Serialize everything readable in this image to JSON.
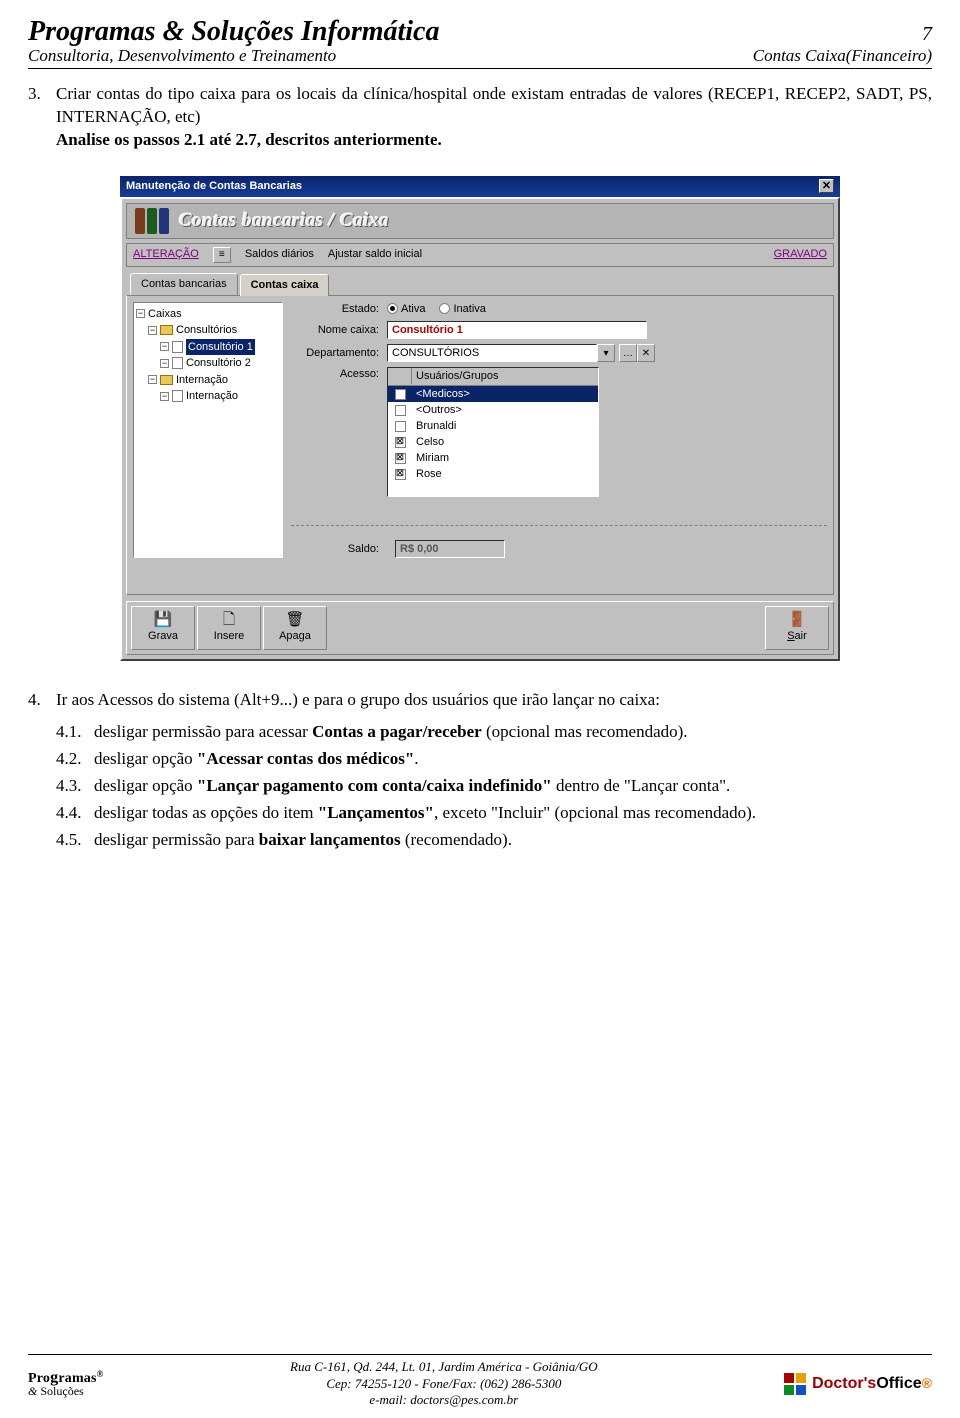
{
  "header": {
    "title": "Programas & Soluções Informática",
    "page_no": "7",
    "subtitle_left": "Consultoria, Desenvolvimento e Treinamento",
    "subtitle_right": "Contas Caixa(Financeiro)"
  },
  "section3": {
    "num": "3.",
    "text_before_bold": "Criar contas do tipo caixa para os locais da clínica/hospital onde existam entradas de valores (RECEP1, RECEP2, SADT, PS, INTERNAÇÃO, etc)",
    "bold": "Analise os passos 2.1 até 2.7, descritos anteriormente."
  },
  "app": {
    "title": "Manutenção de Contas Bancarias",
    "banner": "Contas bancarias / Caixa",
    "toolbar": {
      "alteracao": "ALTERAÇÃO",
      "saldos": "Saldos diários",
      "ajustar": "Ajustar saldo inicial",
      "gravado": "GRAVADO"
    },
    "tabs": {
      "bancarias": "Contas bancarias",
      "caixa": "Contas caixa"
    },
    "tree": {
      "root": "Caixas",
      "n1": "Consultórios",
      "n1a": "Consultório 1",
      "n1b": "Consultório 2",
      "n2": "Internação",
      "n2a": "Internação"
    },
    "form": {
      "estado_lbl": "Estado:",
      "ativa": "Ativa",
      "inativa": "Inativa",
      "nome_lbl": "Nome caixa:",
      "nome_val": "Consultório 1",
      "dep_lbl": "Departamento:",
      "dep_val": "CONSULTÓRIOS",
      "acesso_lbl": "Acesso:",
      "list_header": "Usuários/Grupos",
      "items": [
        {
          "label": "<Medicos>",
          "checked": false,
          "selected": true
        },
        {
          "label": "<Outros>",
          "checked": false,
          "selected": false
        },
        {
          "label": "Brunaldi",
          "checked": false,
          "selected": false
        },
        {
          "label": "Celso",
          "checked": true,
          "selected": false
        },
        {
          "label": "Miriam",
          "checked": true,
          "selected": false
        },
        {
          "label": "Rose",
          "checked": true,
          "selected": false
        }
      ],
      "saldo_lbl": "Saldo:",
      "saldo_val": "R$ 0,00"
    },
    "buttons": {
      "grava": "Grava",
      "insere": "Insere",
      "apaga": "Apaga",
      "sair": "Sair"
    }
  },
  "section4": {
    "num": "4.",
    "text": "Ir aos Acessos do sistema (Alt+9...) e para o grupo dos usuários que irão lançar no caixa:",
    "items": [
      {
        "n": "4.1.",
        "t_pre": "desligar permissão para acessar ",
        "t_b": "Contas a pagar/receber",
        "t_post": " (opcional mas recomendado)."
      },
      {
        "n": "4.2.",
        "t_pre": "desligar opção ",
        "t_b": "\"Acessar contas dos médicos\"",
        "t_post": "."
      },
      {
        "n": "4.3.",
        "t_pre": "desligar opção ",
        "t_b": "\"Lançar pagamento com conta/caixa indefinido\"",
        "t_post": " dentro de \"Lançar conta\"."
      },
      {
        "n": "4.4.",
        "t_pre": "desligar todas as opções do item ",
        "t_b": "\"Lançamentos\"",
        "t_post": ", exceto \"Incluir\" (opcional mas recomendado)."
      },
      {
        "n": "4.5.",
        "t_pre": "desligar permissão para ",
        "t_b": "baixar lançamentos",
        "t_post": " (recomendado)."
      }
    ]
  },
  "footer": {
    "logo_line1_pre": "Pro",
    "logo_line1_g": "g",
    "logo_line1_post": "ramas",
    "logo_reg": "®",
    "logo_line2_amp": "&",
    "logo_line2_s": "S",
    "logo_line2_rest": "oluções",
    "addr1": "Rua C-161, Qd. 244, Lt. 01, Jardim América - Goiânia/GO",
    "addr2": "Cep: 74255-120  - Fone/Fax: (062) 286-5300",
    "addr3": "e-mail: doctors@pes.com.br",
    "dr_pre": "Doctor's",
    "dr_post": "Office",
    "dr_reg": "®"
  }
}
